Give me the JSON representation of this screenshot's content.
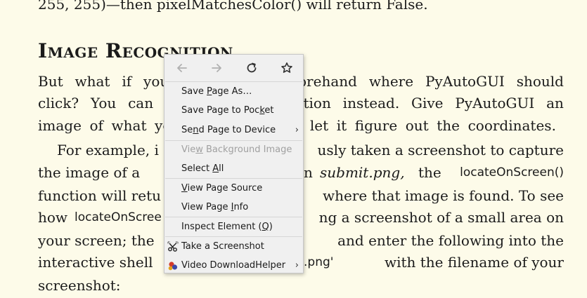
{
  "document": {
    "line0": "255, 255)—then pixelMatchesColor() will return False.",
    "heading": "Image Recognition",
    "p1": [
      [
        "But",
        "what",
        "if",
        "you",
        "",
        "",
        "",
        "orehand",
        "where",
        "PyAutoGUI",
        "should"
      ],
      [
        "click?",
        "You",
        "can",
        "u",
        "",
        "tion",
        "instead.",
        "Give",
        "PyAutoGUI",
        "an"
      ],
      [
        "image",
        "of",
        "what",
        "yo",
        "",
        "d",
        "let",
        "it",
        "figure",
        "out",
        "the",
        "coordinates."
      ]
    ],
    "p2_line1_left": "For example, i",
    "p2_line1_right": "usly taken a screenshot to capture",
    "p2_line2_a": "the image of a",
    "p2_line2_b": "n",
    "p2_line2_file": "submit.png,",
    "p2_line2_c": "the",
    "p2_line2_code": "locateOnScreen()",
    "p2_line3_left": "function will retu",
    "p2_line3_right": "where that image is found. To see",
    "p2_line4_left": "how",
    "p2_line4_code": "locateOnScree",
    "p2_line4_right": "ng a screenshot of a small area on",
    "p2_line5_left": "your screen; the",
    "p2_line5_right": "and enter the following into the",
    "p2_line6_left": "interactive shell",
    "p2_line6_code": ".png'",
    "p2_line6_right": "with the filename of your",
    "p2_line7": "screenshot:"
  },
  "context_menu": {
    "nav": {
      "back_icon": "arrow-left-icon",
      "forward_icon": "arrow-right-icon",
      "reload_icon": "reload-icon",
      "bookmark_icon": "star-icon"
    },
    "items": {
      "save_page_as": {
        "pre": "Save ",
        "u": "P",
        "post": "age As…"
      },
      "save_to_pocket": {
        "pre": "Save Page to Poc",
        "u": "k",
        "post": "et"
      },
      "send_page": {
        "pre": "Se",
        "u": "n",
        "post": "d Page to Device"
      },
      "view_background": {
        "pre": "Vie",
        "u": "w",
        "post": " Background Image"
      },
      "select_all": {
        "pre": "Select ",
        "u": "A",
        "post": "ll"
      },
      "view_source": {
        "pre": "",
        "u": "V",
        "post": "iew Page Source"
      },
      "view_info": {
        "pre": "View Page ",
        "u": "I",
        "post": "nfo"
      },
      "inspect": {
        "pre": "Inspect Element (",
        "u": "Q",
        "post": ")"
      },
      "screenshot": {
        "pre": "Take a Screenshot",
        "u": "",
        "post": ""
      },
      "video_helper": {
        "pre": "Video DownloadHelper",
        "u": "",
        "post": ""
      }
    },
    "submenu_arrow": "›"
  }
}
